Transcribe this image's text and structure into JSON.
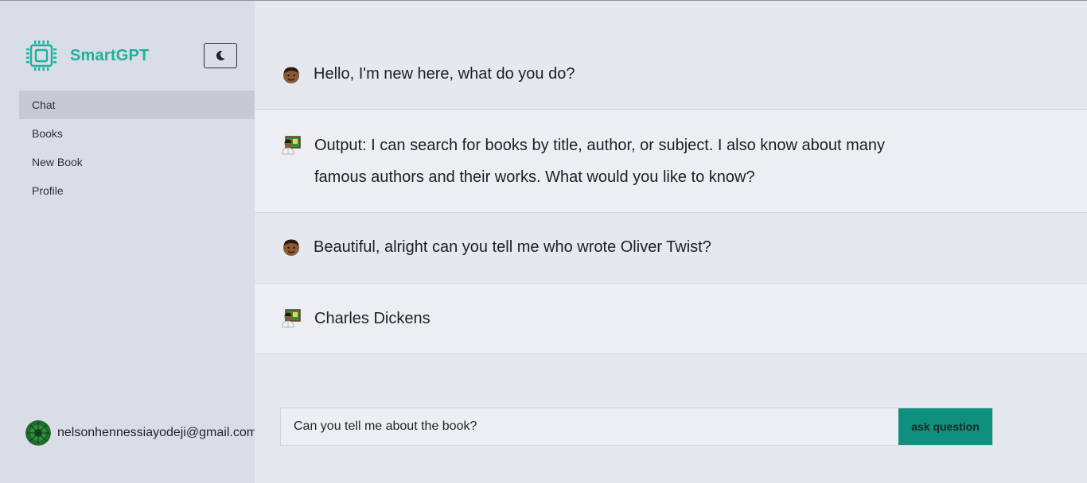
{
  "brand": {
    "name": "SmartGPT"
  },
  "colors": {
    "brand": "#19b39b",
    "accent_button": "#0f8f7d",
    "sidebar_bg": "#d9dde7",
    "active_nav": "#c6cad5"
  },
  "theme_toggle": {
    "icon": "moon-icon"
  },
  "nav": {
    "items": [
      {
        "label": "Chat",
        "active": true
      },
      {
        "label": "Books",
        "active": false
      },
      {
        "label": "New Book",
        "active": false
      },
      {
        "label": "Profile",
        "active": false
      }
    ]
  },
  "user": {
    "email": "nelsonhennessiayodeji@gmail.com",
    "avatar_icon": "avatar"
  },
  "messages": [
    {
      "role": "user",
      "icon": "man-face-icon",
      "text": "Hello, I'm new here, what do you do?"
    },
    {
      "role": "bot",
      "icon": "teacher-icon",
      "text": "Output: I can search for books by title, author, or subject. I also know about many famous authors and their works. What would you like to know?"
    },
    {
      "role": "user",
      "icon": "man-face-icon",
      "text": "Beautiful, alright can you tell me who wrote Oliver Twist?"
    },
    {
      "role": "bot",
      "icon": "teacher-icon",
      "text": "Charles Dickens"
    }
  ],
  "ask": {
    "value": "Can you tell me about the book?",
    "button_label": "ask question"
  }
}
